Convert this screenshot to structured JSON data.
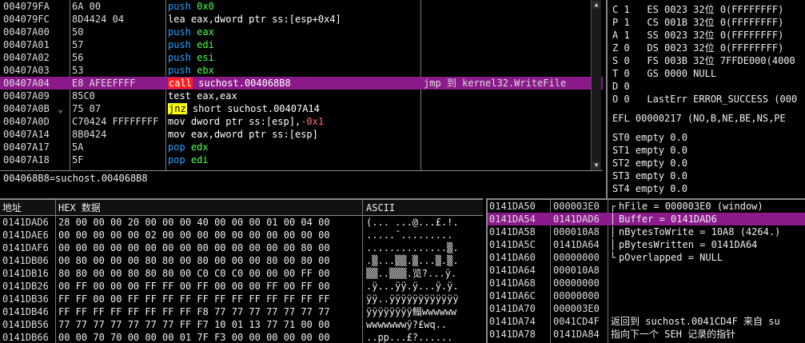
{
  "disasm": {
    "rows": [
      {
        "addr": "004079FA",
        "mark": "",
        "hex": "6A 00",
        "mnem": "push",
        "ops": "0x0",
        "comment": "",
        "sel": false
      },
      {
        "addr": "004079FC",
        "mark": "",
        "hex": "8D4424 04",
        "mnem": "lea",
        "ops": "eax,dword ptr ss:[esp+0x4]",
        "comment": "",
        "sel": false
      },
      {
        "addr": "00407A00",
        "mark": "",
        "hex": "50",
        "mnem": "push",
        "ops": "eax",
        "comment": "",
        "sel": false
      },
      {
        "addr": "00407A01",
        "mark": "",
        "hex": "57",
        "mnem": "push",
        "ops": "edi",
        "comment": "",
        "sel": false
      },
      {
        "addr": "00407A02",
        "mark": "",
        "hex": "56",
        "mnem": "push",
        "ops": "esi",
        "comment": "",
        "sel": false
      },
      {
        "addr": "00407A03",
        "mark": "",
        "hex": "53",
        "mnem": "push",
        "ops": "ebx",
        "comment": "",
        "sel": false
      },
      {
        "addr": "00407A04",
        "mark": "",
        "hex": "E8 AFEEFFFF",
        "mnem": "call",
        "ops": "suchost.004068B8",
        "comment": "jmp 到 kernel32.WriteFile",
        "sel": true
      },
      {
        "addr": "00407A09",
        "mark": "",
        "hex": "85C0",
        "mnem": "test",
        "ops": "eax,eax",
        "comment": "",
        "sel": false
      },
      {
        "addr": "00407A0B",
        "mark": "⌄",
        "hex": "75 07",
        "mnem": "jnz",
        "ops": "short suchost.00407A14",
        "comment": "",
        "sel": false
      },
      {
        "addr": "00407A0D",
        "mark": "",
        "hex": "C70424 FFFFFFFF",
        "mnem": "mov",
        "ops": "dword ptr ss:[esp],",
        "neg": "-0x1",
        "comment": "",
        "sel": false
      },
      {
        "addr": "00407A14",
        "mark": "",
        "hex": "8B0424",
        "mnem": "mov",
        "ops": "eax,dword ptr ss:[esp]",
        "comment": "",
        "sel": false
      },
      {
        "addr": "00407A17",
        "mark": "",
        "hex": "5A",
        "mnem": "pop",
        "ops": "edx",
        "comment": "",
        "sel": false
      },
      {
        "addr": "00407A18",
        "mark": "",
        "hex": "5F",
        "mnem": "pop",
        "ops": "edi",
        "comment": "",
        "sel": false
      }
    ]
  },
  "info_line": "004068B8=suchost.004068B8",
  "regs": {
    "flags": [
      "C 1   ES 0023 32位 0(FFFFFFFF)",
      "P 1   CS 001B 32位 0(FFFFFFFF)",
      "A 1   SS 0023 32位 0(FFFFFFFF)",
      "Z 0   DS 0023 32位 0(FFFFFFFF)",
      "S 0   FS 003B 32位 7FFDE000(4000",
      "T 0   GS 0000 NULL",
      "D 0",
      "O 0   LastErr ERROR_SUCCESS (000"
    ],
    "efl": "EFL 00000217 (NO,B,NE,BE,NS,PE",
    "fpu": [
      "ST0 empty 0.0",
      "ST1 empty 0.0",
      "ST2 empty 0.0",
      "ST3 empty 0.0",
      "ST4 empty 0.0"
    ]
  },
  "dump": {
    "header": {
      "addr": "地址",
      "hex": "HEX 数据",
      "ascii": "ASCII"
    },
    "rows": [
      {
        "addr": "0141DAD6",
        "hex": "28 00 00 00 20 00 00 00 40 00 00 00 01 00 04 00",
        "ascii": "(... ...@...£.!."
      },
      {
        "addr": "0141DAE6",
        "hex": "00 00 00 00 00 02 00 00 00 00 00 00 00 00 00 00",
        "ascii": ".....¯........."
      },
      {
        "addr": "0141DAF6",
        "hex": "00 00 00 00 00 00 00 00 00 00 00 00 00 00 80 00",
        "ascii": "..............▒."
      },
      {
        "addr": "0141DB06",
        "hex": "00 80 00 00 00 80 80 00 80 00 00 00 80 00 80 00",
        "ascii": ".▒...▒▒.▒...▒.▒."
      },
      {
        "addr": "0141DB16",
        "hex": "80 80 00 00 80 80 80 00 C0 C0 C0 00 00 00 FF 00",
        "ascii": "▒▒..▒▒▒.览?...ÿ."
      },
      {
        "addr": "0141DB26",
        "hex": "00 FF 00 00 00 FF FF 00 FF 00 00 00 FF 00 FF 00",
        "ascii": ".ÿ...ÿÿ.ÿ...ÿ.ÿ."
      },
      {
        "addr": "0141DB36",
        "hex": "FF FF 00 00 FF FF FF FF FF FF FF FF FF FF FF FF",
        "ascii": "ÿÿ..ÿÿÿÿÿÿÿÿÿÿÿÿ"
      },
      {
        "addr": "0141DB46",
        "hex": "FF FF FF FF FF FF FF FF F8 77 77 77 77 77 77 77",
        "ascii": "ÿÿÿÿÿÿÿÿ鳎wwwwww"
      },
      {
        "addr": "0141DB56",
        "hex": "77 77 77 77 77 77 77 FF F7 10 01 13 77 71 00 00",
        "ascii": "wwwwwwwÿ?£wq.."
      },
      {
        "addr": "0141DB66",
        "hex": "00 00 70 70 00 00 00 01 7F F3 00 00 00 00 00 00",
        "ascii": "..pp...£?......"
      }
    ]
  },
  "stack": {
    "rows": [
      {
        "addr": "0141DA50",
        "val": "000003E0",
        "cmt": "hFile = 000003E0 (window)",
        "sel": false,
        "tree": "┌"
      },
      {
        "addr": "0141DA54",
        "val": "0141DAD6",
        "cmt": "Buffer = 0141DAD6",
        "sel": true,
        "tree": "│"
      },
      {
        "addr": "0141DA58",
        "val": "000010A8",
        "cmt": "nBytesToWrite = 10A8 (4264.)",
        "sel": false,
        "tree": "│"
      },
      {
        "addr": "0141DA5C",
        "val": "0141DA64",
        "cmt": "pBytesWritten = 0141DA64",
        "sel": false,
        "tree": "│"
      },
      {
        "addr": "0141DA60",
        "val": "00000000",
        "cmt": "pOverlapped = NULL",
        "sel": false,
        "tree": "└"
      },
      {
        "addr": "0141DA64",
        "val": "000010A8",
        "cmt": "",
        "sel": false,
        "tree": ""
      },
      {
        "addr": "0141DA68",
        "val": "00000000",
        "cmt": "",
        "sel": false,
        "tree": ""
      },
      {
        "addr": "0141DA6C",
        "val": "00000000",
        "cmt": "",
        "sel": false,
        "tree": ""
      },
      {
        "addr": "0141DA70",
        "val": "000003E0",
        "cmt": "",
        "sel": false,
        "tree": ""
      },
      {
        "addr": "0141DA74",
        "val": "0041CD4F",
        "cmt": "返回到 suchost.0041CD4F 来自 su",
        "sel": false,
        "tree": ""
      },
      {
        "addr": "0141DA78",
        "val": "0141DA84",
        "cmt": "指向下一个 SEH 记录的指针",
        "sel": false,
        "tree": ""
      }
    ]
  }
}
